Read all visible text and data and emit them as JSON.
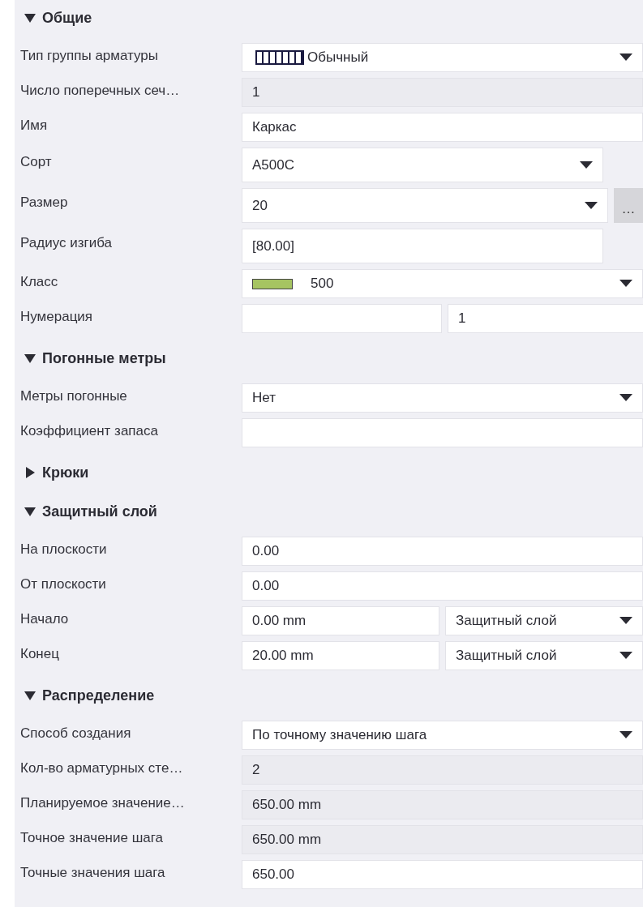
{
  "sections": [
    {
      "title": "Общие",
      "expanded": true,
      "rows": [
        {
          "label": "Тип группы арматуры",
          "fields": [
            {
              "kind": "pattern-dropdown",
              "value": "Обычный"
            }
          ]
        },
        {
          "label": "Число поперечных сеч…",
          "fields": [
            {
              "kind": "readonly",
              "value": "1"
            }
          ]
        },
        {
          "label": "Имя",
          "fields": [
            {
              "kind": "text",
              "value": "Каркас"
            }
          ]
        },
        {
          "label": "Сорт",
          "short": true,
          "fields": [
            {
              "kind": "dropdown",
              "value": "A500C"
            }
          ]
        },
        {
          "label": "Размер",
          "short": true,
          "button": "…",
          "fields": [
            {
              "kind": "dropdown",
              "value": "20"
            }
          ]
        },
        {
          "label": "Радиус изгиба",
          "short": true,
          "fields": [
            {
              "kind": "text",
              "value": "[80.00]"
            }
          ]
        },
        {
          "label": "Класс",
          "fields": [
            {
              "kind": "swatch-dropdown",
              "color": "#a6c462",
              "value": "500"
            }
          ]
        },
        {
          "label": "Нумерация",
          "fields": [
            {
              "kind": "text"
            },
            {
              "kind": "text",
              "value": "1"
            }
          ]
        }
      ]
    },
    {
      "title": "Погонные метры",
      "expanded": true,
      "rows": [
        {
          "label": "Метры погонные",
          "fields": [
            {
              "kind": "dropdown",
              "value": "Нет"
            }
          ]
        },
        {
          "label": "Коэффициент запаса",
          "fields": [
            {
              "kind": "text"
            }
          ]
        }
      ]
    },
    {
      "title": "Крюки",
      "expanded": false
    },
    {
      "title": "Защитный слой",
      "expanded": true,
      "rows": [
        {
          "label": "На плоскости",
          "fields": [
            {
              "kind": "text",
              "value": "0.00"
            }
          ]
        },
        {
          "label": "От плоскости",
          "fields": [
            {
              "kind": "text",
              "value": "0.00"
            }
          ]
        },
        {
          "label": "Начало",
          "fields": [
            {
              "kind": "text",
              "value": "0.00 mm"
            },
            {
              "kind": "dropdown",
              "value": "Защитный слой"
            }
          ]
        },
        {
          "label": "Конец",
          "fields": [
            {
              "kind": "text",
              "value": "20.00 mm"
            },
            {
              "kind": "dropdown",
              "value": "Защитный слой"
            }
          ]
        }
      ]
    },
    {
      "title": "Распределение",
      "expanded": true,
      "rows": [
        {
          "label": "Способ создания",
          "fields": [
            {
              "kind": "dropdown",
              "value": "По точному значению шага"
            }
          ]
        },
        {
          "label": "Кол-во арматурных сте…",
          "fields": [
            {
              "kind": "readonly",
              "value": "2"
            }
          ]
        },
        {
          "label": "Планируемое значение…",
          "fields": [
            {
              "kind": "readonly",
              "value": "650.00 mm"
            }
          ]
        },
        {
          "label": "Точное значение шага",
          "fields": [
            {
              "kind": "readonly",
              "value": "650.00 mm"
            }
          ]
        },
        {
          "label": "Точные значения шага",
          "fields": [
            {
              "kind": "text",
              "value": "650.00"
            }
          ]
        }
      ]
    }
  ]
}
